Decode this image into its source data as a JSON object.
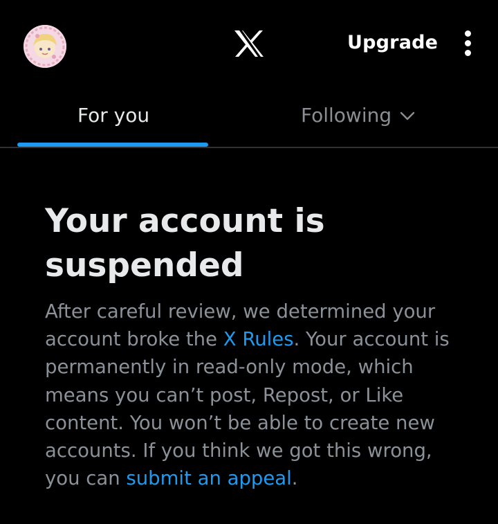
{
  "header": {
    "logo_icon": "x-logo-icon",
    "upgrade_label": "Upgrade",
    "more_icon": "more-vertical-icon"
  },
  "tabs": [
    {
      "label": "For you",
      "active": true
    },
    {
      "label": "Following",
      "active": false,
      "icon": "chevron-down-icon"
    }
  ],
  "notice": {
    "title": "Your account is suspended",
    "body_part1": "After careful review, we determined your account broke the ",
    "rules_link": "X Rules",
    "body_part2": ". Your account is permanently in read-only mode, which means you can’t post, Repost, or Like content. You won’t be able to create new accounts. If you think we got this wrong, you can ",
    "appeal_link": "submit an appeal",
    "body_end": "."
  },
  "colors": {
    "background": "#000000",
    "accent": "#1d9bf0",
    "primary_text": "#e7e9ea",
    "secondary_text": "#8b9198"
  }
}
